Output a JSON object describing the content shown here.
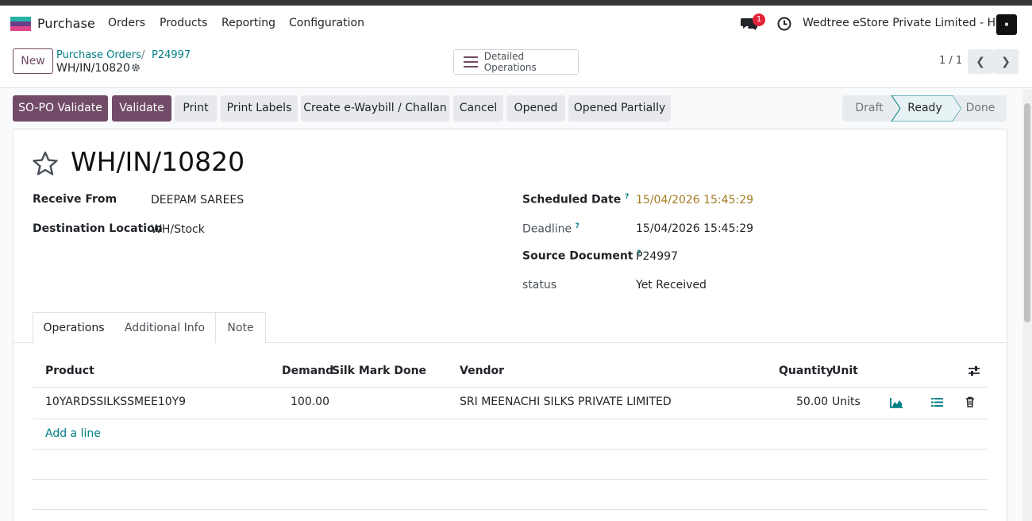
{
  "navbar": {
    "app_name": "Purchase",
    "menus": [
      "Orders",
      "Products",
      "Reporting",
      "Configuration"
    ],
    "chat_badge": "1",
    "company": "Wedtree eStore Private Limited - HO",
    "app_icon_colors": [
      "#26b3a5",
      "#6a3e8a",
      "#e0468a"
    ]
  },
  "control": {
    "new_label": "New",
    "breadcrumb_parent": "Purchase Orders",
    "breadcrumb_sep": "/",
    "breadcrumb_link": "P24997",
    "breadcrumb_current": "WH/IN/10820",
    "detailed_label": "Detailed Operations",
    "pager": "1 / 1"
  },
  "actions": {
    "so_po_validate": "SO-PO Validate",
    "validate": "Validate",
    "print": "Print",
    "print_labels": "Print Labels",
    "eway": "Create e-Waybill / Challan",
    "cancel": "Cancel",
    "opened": "Opened",
    "opened_partially": "Opened Partially"
  },
  "status": {
    "draft": "Draft",
    "ready": "Ready",
    "done": "Done",
    "current": "Ready"
  },
  "form": {
    "title": "WH/IN/10820",
    "receive_from_label": "Receive From",
    "receive_from": "DEEPAM SAREES",
    "destination_label": "Destination Location",
    "destination": "WH/Stock",
    "scheduled_label": "Scheduled Date",
    "scheduled": "15/04/2026 15:45:29",
    "deadline_label": "Deadline",
    "deadline": "15/04/2026 15:45:29",
    "source_label": "Source Document",
    "source": "P24997",
    "status_label": "status",
    "status_value": "Yet Received",
    "help_mark": "?"
  },
  "tabs": [
    "Operations",
    "Additional Info",
    "Note"
  ],
  "table": {
    "headers": {
      "product": "Product",
      "demand": "Demand",
      "silk": "Silk Mark Done",
      "vendor": "Vendor",
      "quantity": "Quantity",
      "unit": "Unit"
    },
    "rows": [
      {
        "product": "10YARDSSILKSSMEE10Y9",
        "demand": "100.00",
        "vendor": "SRI MEENACHI SILKS PRIVATE LIMITED",
        "quantity": "50.00",
        "unit": "Units"
      }
    ],
    "add_line": "Add a line"
  }
}
